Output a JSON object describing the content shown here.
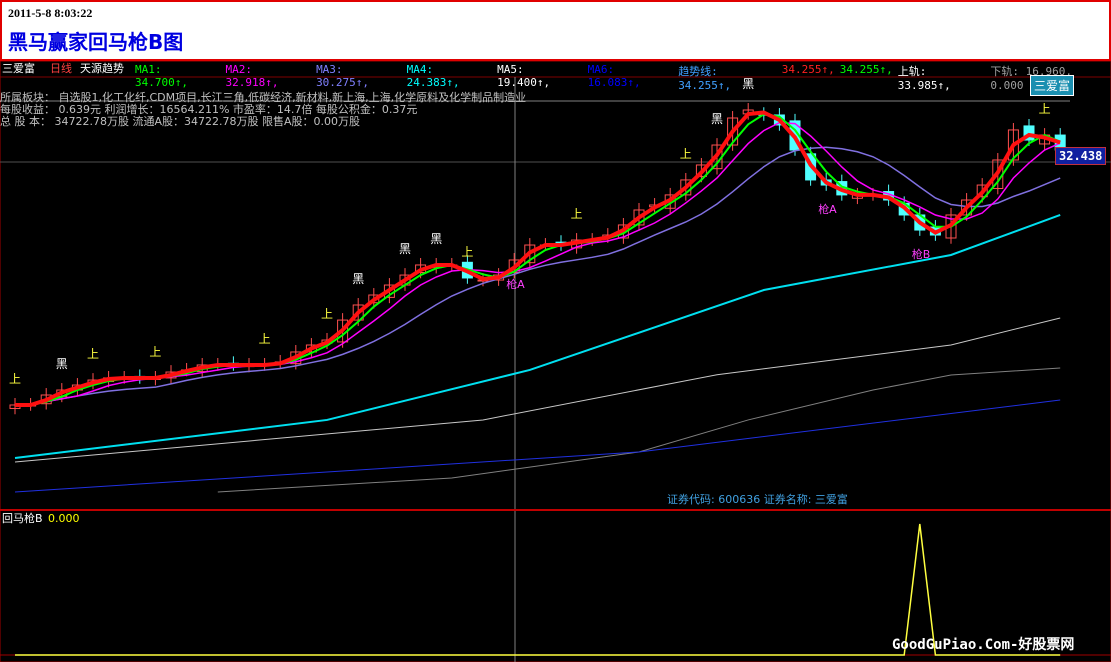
{
  "window": {
    "timestamp": "2011-5-8 8:03:22",
    "title": "黑马赢家回马枪B图"
  },
  "header": {
    "stock": "三爱富",
    "period": "日线",
    "indicator": "天源趋势",
    "items": [
      {
        "label": "MA1: 34.700↑,",
        "color": "#00ff00"
      },
      {
        "label": "MA2: 32.918↑,",
        "color": "#ff00ff"
      },
      {
        "label": "MA3: 30.275↑,",
        "color": "#8080ff"
      },
      {
        "label": "MA4: 24.383↑,",
        "color": "#00ffff"
      },
      {
        "label": "MA5: 19.400↑,",
        "color": "#ffffff"
      },
      {
        "label": "MA6: 16.083↑,",
        "color": "#0000ff"
      },
      {
        "label": "趋势线: 34.255↑,",
        "color": "#40a0ff"
      },
      {
        "label": "34.255↑,",
        "color": "#ff2020"
      },
      {
        "label": "34.255↑,",
        "color": "#00ff00"
      },
      {
        "label": "上轨: 33.985↑,",
        "color": "#ffffff"
      },
      {
        "label": "下轨: 16.960, 0.000",
        "color": "#a0a0a0"
      }
    ]
  },
  "info": {
    "line1": "所属板块： 自选股1,化工化纤,CDM项目,长江三角,低碳经济,新材料,新上海,上海,化学原料及化学制品制造业",
    "line2": "每股收益： 0.639元    利润增长：16564.211%    市盈率：14.7倍   每股公积金：0.37元",
    "line3": "总 股 本： 34722.78万股  流通A股：34722.78万股  限售A股：0.00万股"
  },
  "stock_box": "三爱富",
  "price_label": "32.438",
  "security": "证券代码: 600636 证券名称: 三爱富",
  "sub": {
    "label": "回马枪B",
    "value": "0.000"
  },
  "watermark": "GoodGuPiao.Com-好股票网",
  "chart_data": [
    {
      "type": "candlestick",
      "title": "三爱富 日线",
      "ylim": [
        0,
        37
      ],
      "close": [
        10.89,
        10.89,
        11.75,
        12.18,
        12.61,
        13.04,
        13.22,
        13.22,
        13.22,
        13.22,
        13.73,
        13.91,
        14.34,
        14.34,
        14.34,
        14.34,
        14.34,
        14.6,
        15.46,
        16.06,
        16.49,
        18.21,
        19.51,
        20.37,
        21.23,
        22.09,
        22.96,
        22.96,
        22.96,
        21.84,
        21.66,
        22.09,
        23.39,
        24.68,
        24.68,
        24.68,
        25.11,
        25.11,
        25.54,
        26.41,
        27.7,
        28.13,
        29.0,
        30.29,
        31.58,
        33.3,
        35.63,
        36.32,
        35.89,
        35.03,
        32.87,
        30.29,
        29.85,
        29.0,
        29.0,
        29.0,
        28.56,
        27.27,
        25.97,
        25.54,
        27.27,
        28.56,
        29.85,
        32.01,
        34.6,
        33.73,
        34.16,
        32.87
      ],
      "ma_lines": [
        {
          "name": "MA4",
          "color": "#00e0f0",
          "points": [
            [
              0,
              6.32
            ],
            [
              20,
              9.6
            ],
            [
              33,
              13.91
            ],
            [
              48,
              20.8
            ],
            [
              60,
              23.82
            ],
            [
              67,
              27.27
            ]
          ]
        },
        {
          "name": "MA5",
          "color": "#c8c8c8",
          "points": [
            [
              0,
              5.97
            ],
            [
              30,
              9.6
            ],
            [
              45,
              13.5
            ],
            [
              60,
              16.06
            ],
            [
              67,
              18.39
            ]
          ]
        },
        {
          "name": "MA6-gray",
          "color": "#808080",
          "points": [
            [
              13,
              3.39
            ],
            [
              28,
              4.6
            ],
            [
              40,
              6.84
            ],
            [
              47,
              9.6
            ],
            [
              55,
              12.18
            ],
            [
              60,
              13.47
            ],
            [
              67,
              14.08
            ]
          ]
        },
        {
          "name": "MA6",
          "color": "#2030e0",
          "points": [
            [
              0,
              3.39
            ],
            [
              40,
              6.84
            ],
            [
              67,
              11.32
            ]
          ]
        }
      ],
      "annotations": [
        {
          "i": 0,
          "text": "上"
        },
        {
          "i": 3,
          "text": "黑"
        },
        {
          "i": 5,
          "text": "上"
        },
        {
          "i": 9,
          "text": "上"
        },
        {
          "i": 16,
          "text": "上"
        },
        {
          "i": 20,
          "text": "上"
        },
        {
          "i": 22,
          "text": "黑"
        },
        {
          "i": 25,
          "text": "黑"
        },
        {
          "i": 27,
          "text": "黑"
        },
        {
          "i": 29,
          "text": "上"
        },
        {
          "i": 36,
          "text": "上"
        },
        {
          "i": 43,
          "text": "上"
        },
        {
          "i": 45,
          "text": "黑"
        },
        {
          "i": 47,
          "text": "黑"
        },
        {
          "i": 66,
          "text": "上"
        }
      ],
      "signals": [
        {
          "i": 32,
          "text": "枪A"
        },
        {
          "i": 52,
          "text": "枪A"
        },
        {
          "i": 58,
          "text": "枪B"
        }
      ]
    },
    {
      "type": "line",
      "title": "回马枪B",
      "ylim": [
        0,
        1
      ],
      "values_nonzero": [
        {
          "i": 58,
          "v": 1
        }
      ]
    }
  ]
}
